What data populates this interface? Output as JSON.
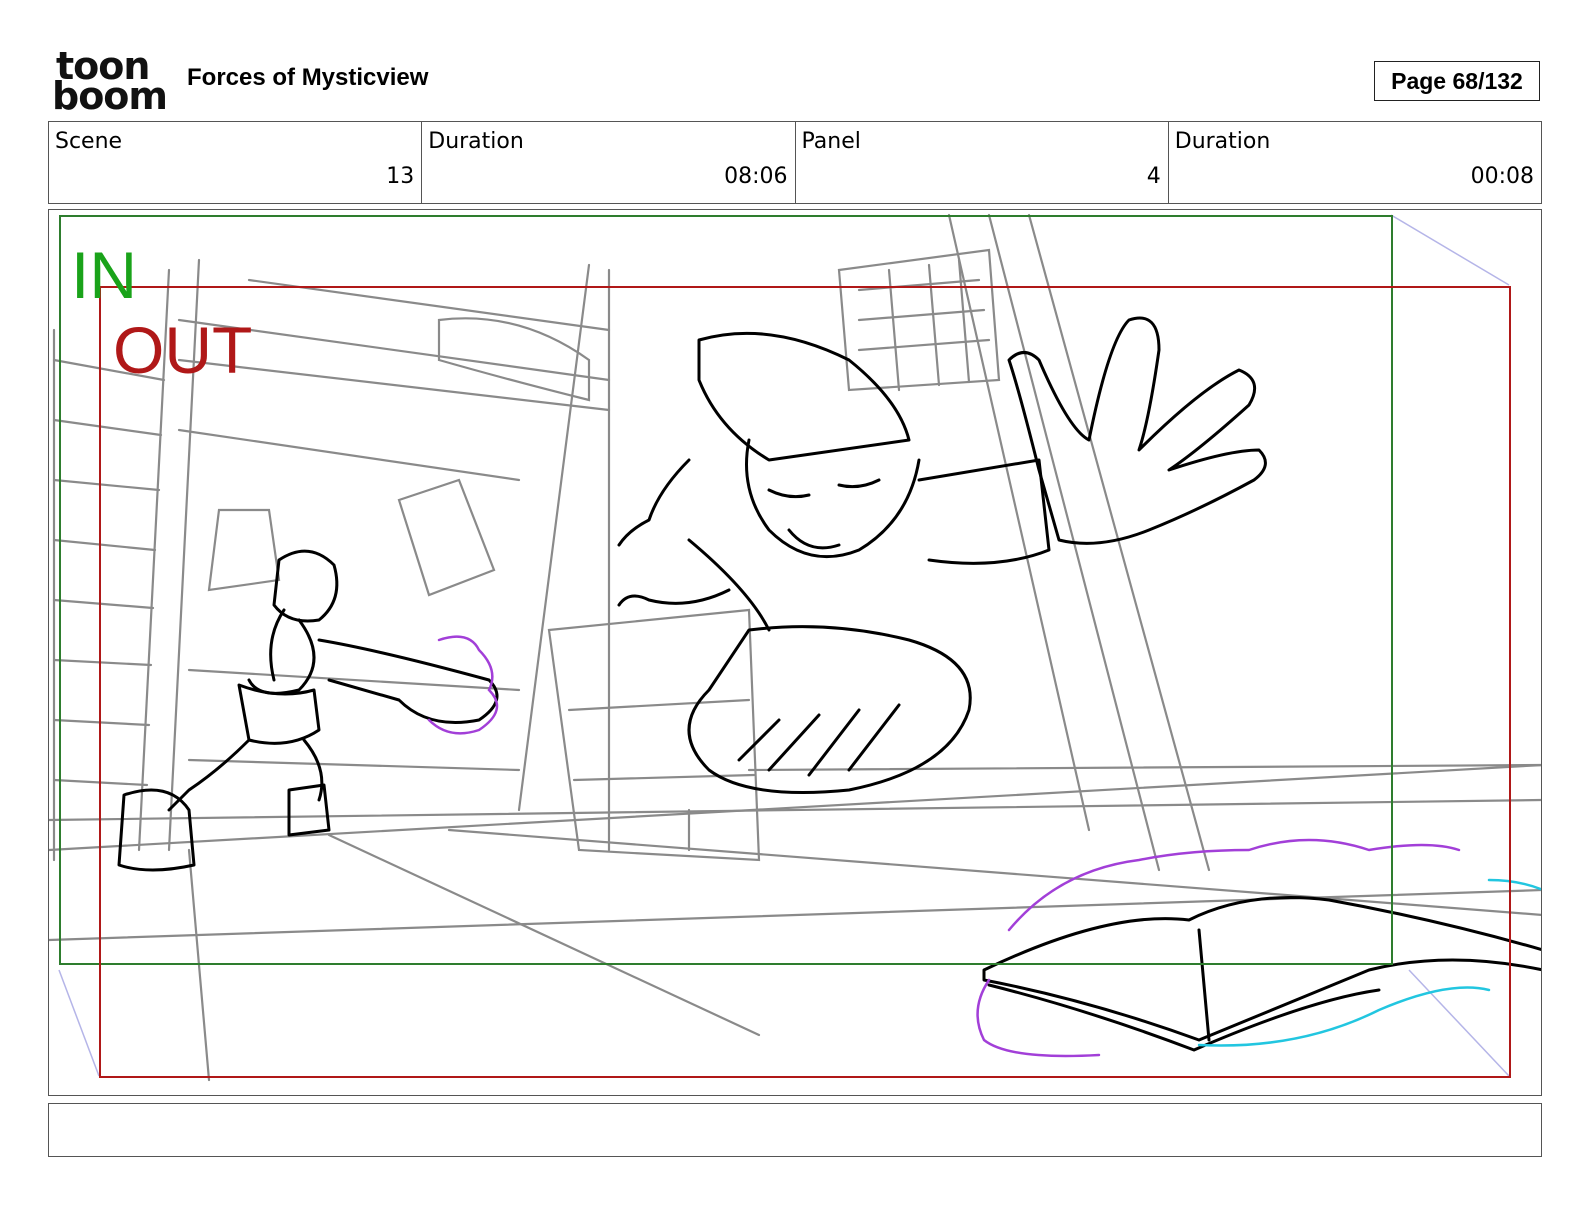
{
  "header": {
    "logo_line1": "toon",
    "logo_line2": "boom",
    "project_title": "Forces of Mysticview",
    "page_label": "Page",
    "page_number": "68/132"
  },
  "info": {
    "scene_label": "Scene",
    "scene_value": "13",
    "scene_duration_label": "Duration",
    "scene_duration_value": "08:06",
    "panel_label": "Panel",
    "panel_value": "4",
    "panel_duration_label": "Duration",
    "panel_duration_value": "00:08"
  },
  "panel": {
    "in_label": "IN",
    "out_label": "OUT",
    "in_color": "#1aa31a",
    "out_color": "#b01818"
  },
  "caption": {
    "text": ""
  }
}
